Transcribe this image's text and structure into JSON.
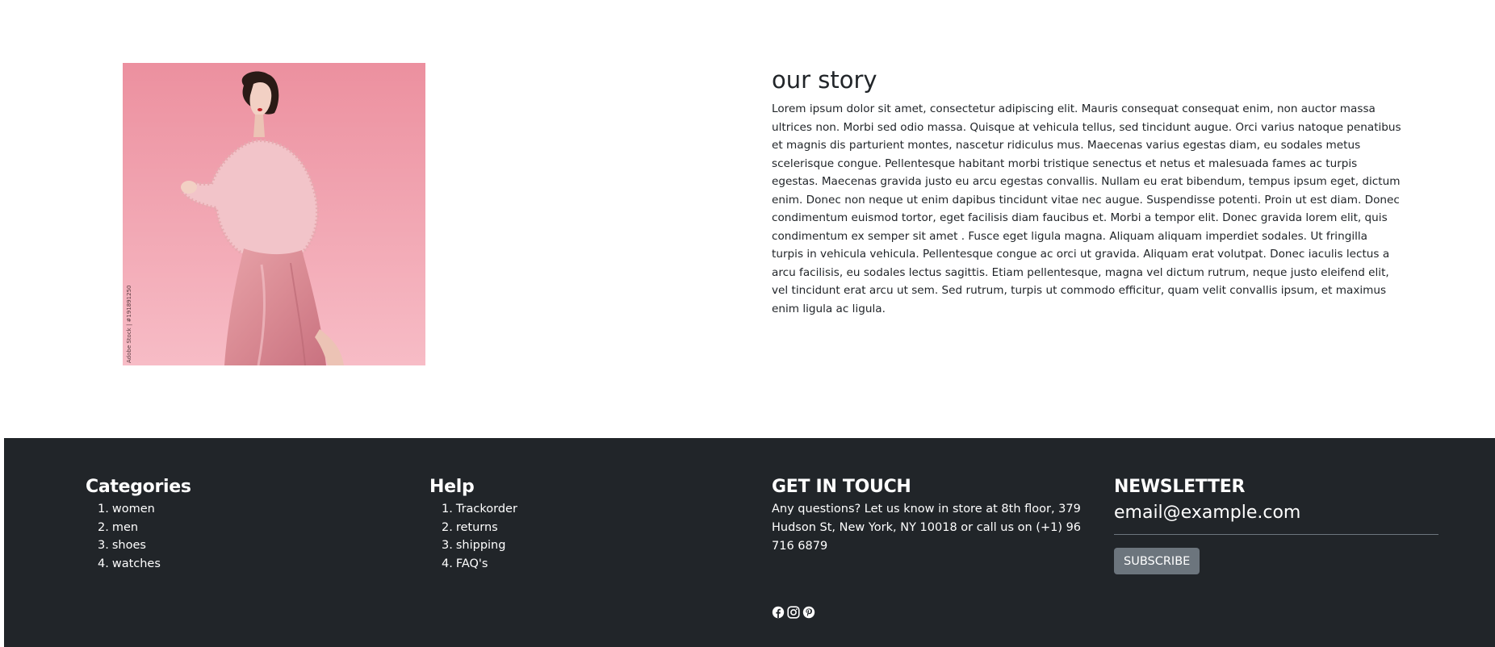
{
  "story": {
    "title": "our story",
    "body": "Lorem ipsum dolor sit amet, consectetur adipiscing elit. Mauris consequat consequat enim, non auctor massa ultrices non. Morbi sed odio massa. Quisque at vehicula tellus, sed tincidunt augue. Orci varius natoque penatibus et magnis dis parturient montes, nascetur ridiculus mus. Maecenas varius egestas diam, eu sodales metus scelerisque congue. Pellentesque habitant morbi tristique senectus et netus et malesuada fames ac turpis egestas. Maecenas gravida justo eu arcu egestas convallis. Nullam eu erat bibendum, tempus ipsum eget, dictum enim. Donec non neque ut enim dapibus tincidunt vitae nec augue. Suspendisse potenti. Proin ut est diam. Donec condimentum euismod tortor, eget facilisis diam faucibus et. Morbi a tempor elit. Donec gravida lorem elit, quis condimentum ex semper sit amet . Fusce eget ligula magna. Aliquam aliquam imperdiet sodales. Ut fringilla turpis in vehicula vehicula. Pellentesque congue ac orci ut gravida. Aliquam erat volutpat. Donec iaculis lectus a arcu facilisis, eu sodales lectus sagittis. Etiam pellentesque, magna vel dictum rutrum, neque justo eleifend elit, vel tincidunt erat arcu ut sem. Sed rutrum, turpis ut commodo efficitur, quam velit convallis ipsum, et maximus enim ligula ac ligula.",
    "image_watermark": "Adobe Stock | #191891250",
    "colors": {
      "image_background": "#f1a5b2"
    }
  },
  "footer": {
    "categories": {
      "heading": "Categories",
      "items": [
        {
          "num": "1.",
          "label": "women"
        },
        {
          "num": "2.",
          "label": "men"
        },
        {
          "num": "3.",
          "label": "shoes"
        },
        {
          "num": "4.",
          "label": "watches"
        }
      ]
    },
    "help": {
      "heading": "Help",
      "items": [
        {
          "num": "1.",
          "label": "Trackorder"
        },
        {
          "num": "2.",
          "label": "returns"
        },
        {
          "num": "3.",
          "label": "shipping"
        },
        {
          "num": "4.",
          "label": "FAQ's"
        }
      ]
    },
    "contact": {
      "heading": "GET IN TOUCH",
      "text": "Any questions? Let us know in store at 8th floor, 379 Hudson St, New York, NY 10018 or call us on (+1) 96 716 6879",
      "social_icons": [
        "facebook-icon",
        "instagram-icon",
        "pinterest-icon"
      ]
    },
    "newsletter": {
      "heading": "NEWSLETTER",
      "email_placeholder": "email@example.com",
      "subscribe_label": "Subscribe"
    },
    "colors": {
      "background": "#212529",
      "text": "#ffffff",
      "button": "#6c757d"
    }
  }
}
